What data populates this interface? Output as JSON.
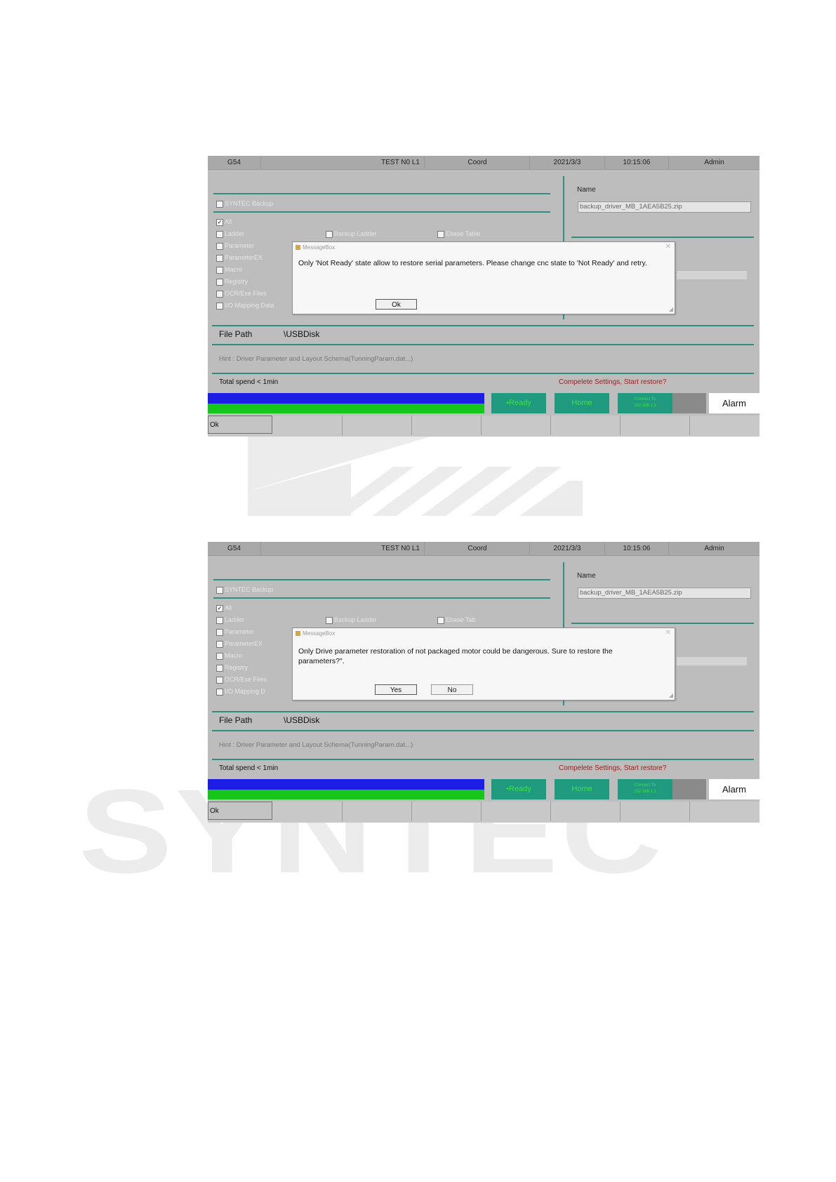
{
  "watermark": {
    "text": "SYNTEC"
  },
  "screens": [
    {
      "topbar": [
        "G54",
        "TEST N0 L1",
        "Coord",
        "2021/3/3",
        "10:15:06",
        "Admin"
      ],
      "checkboxes": {
        "syntec_backup": "SYNTEC Backup",
        "all": "All",
        "ladder": "Ladder",
        "parameter": "Parameter",
        "parameter_ex": "ParameterEX",
        "macro": "Macro",
        "registry": "Registry",
        "ocr_file": "OCR/Exe Files",
        "mapping": "I/O Mapping Data",
        "col2": "Backup Ladder",
        "col3": "Ebase Table"
      },
      "name_label": "Name",
      "name_value": "backup_driver_MB_1AEA5B25.zip",
      "file_path_label": "File Path",
      "file_path_value": "\\USBDisk",
      "hint": "Hint : Driver Parameter and Layout Schema(TunningParam.dat...)",
      "total": "Total spend < 1min",
      "restore_msg": "Compelete Settings, Start restore?",
      "status": {
        "ready": "•Ready",
        "home": "Home",
        "connect": "Connect To",
        "ip": "192.168.1.1",
        "alarm": "Alarm"
      },
      "softkey_ok": "Ok",
      "dialog": {
        "title": "MessageBox",
        "message": "Only 'Not Ready' state allow to restore serial parameters. Please change cnc state to 'Not Ready' and retry.",
        "buttons": [
          "Ok"
        ]
      }
    },
    {
      "topbar": [
        "G54",
        "TEST N0 L1",
        "Coord",
        "2021/3/3",
        "10:15:06",
        "Admin"
      ],
      "checkboxes": {
        "syntec_backup": "SYNTEC Backup",
        "all": "All",
        "ladder": "Ladder",
        "parameter": "Parameter",
        "parameter_ex": "ParameterEX",
        "macro": "Macro",
        "registry": "Registry",
        "ocr_file": "OCR/Exe Files",
        "mapping": "I/O Mapping D",
        "col2": "Backup Ladder",
        "col3": "Ebase Tab"
      },
      "name_label": "Name",
      "name_value": "backup_driver_MB_1AEA5B25.zip",
      "file_path_label": "File Path",
      "file_path_value": "\\USBDisk",
      "hint": "Hint : Driver Parameter and Layout Schema(TunningParam.dat...)",
      "total": "Total spend < 1min",
      "restore_msg": "Compelete Settings, Start restore?",
      "status": {
        "ready": "•Ready",
        "home": "Home",
        "connect": "Connect To",
        "ip": "192.168.1.1",
        "alarm": "Alarm"
      },
      "softkey_ok": "Ok",
      "dialog": {
        "title": "MessageBox",
        "message_line1": "Only Drive parameter restoration of not packaged motor could be dangerous. Sure to restore the",
        "message_line2": "parameters?\".",
        "buttons": [
          "Yes",
          "No"
        ]
      }
    }
  ],
  "colors": {
    "panel": "#bdbdbd",
    "divider": "#2f8f7f",
    "progress_blue": "#1d1de6",
    "progress_green": "#16c61a",
    "status_button": "#1f9a7e",
    "status_text": "#3fe04a",
    "restore_text": "#9b1d1d"
  }
}
